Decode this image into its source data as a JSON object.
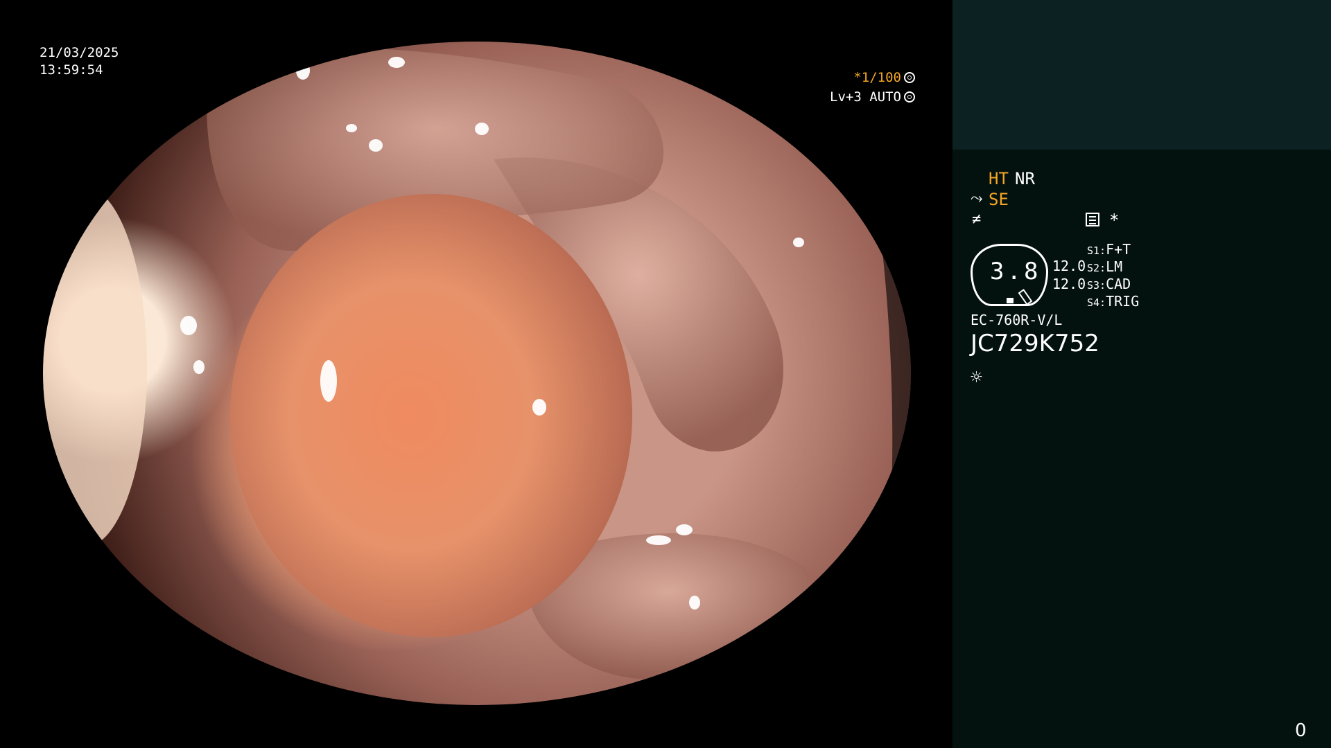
{
  "overlay": {
    "date": "21/03/2025",
    "time": "13:59:54",
    "shutter": "*1/100",
    "level": "Lv+3 AUTO"
  },
  "panel": {
    "mode_ht": "HT",
    "mode_nr": "NR",
    "se": "SE",
    "asterisk": "*",
    "zoom_value": "3.8",
    "value_1": "12.0",
    "value_2": "12.0",
    "s1_key": "S1:",
    "s1_val": "F+T",
    "s2_key": "S2:",
    "s2_val": "LM",
    "s3_key": "S3:",
    "s3_val": "CAD",
    "s4_key": "S4:",
    "s4_val": "TRIG",
    "scope_model": "EC-760R-V/L",
    "scope_serial": "JC729K752"
  },
  "counter": "0",
  "colors": {
    "accent_orange": "#f4a524",
    "panel_bg": "#04120f",
    "panel_top_bg": "#0c2222"
  },
  "icons": {
    "shutter": "aperture-icon",
    "level": "auto-iris-icon",
    "se": "scope-edge-icon",
    "ice": "freeze-icon",
    "list": "settings-list-icon",
    "light": "light-source-icon"
  }
}
